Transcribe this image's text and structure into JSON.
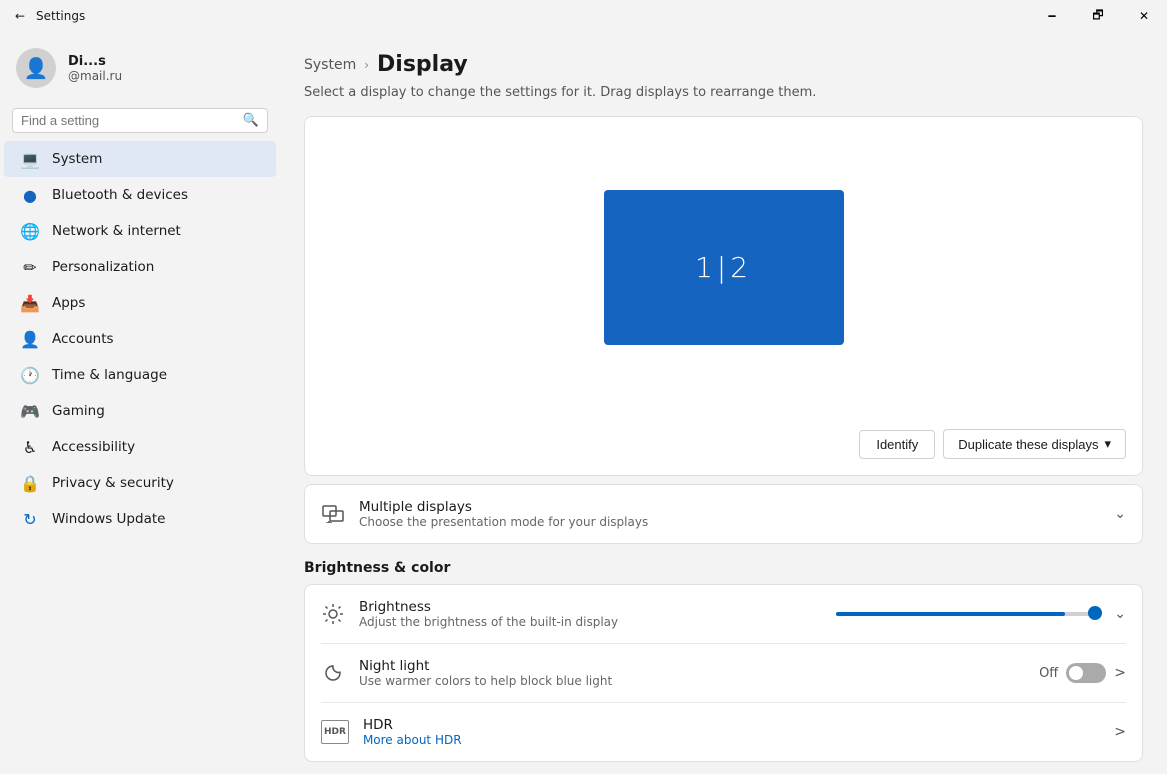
{
  "titlebar": {
    "app_name": "Settings",
    "back_label": "←",
    "minimize_label": "🗕",
    "maximize_label": "🗗",
    "close_label": "✕"
  },
  "sidebar": {
    "user": {
      "name": "Di...s",
      "email": "@mail.ru",
      "avatar_icon": "👤"
    },
    "search": {
      "placeholder": "Find a setting",
      "icon": "🔍"
    },
    "nav_items": [
      {
        "id": "system",
        "label": "System",
        "icon": "💻",
        "active": true
      },
      {
        "id": "bluetooth",
        "label": "Bluetooth & devices",
        "icon": "🔵"
      },
      {
        "id": "network",
        "label": "Network & internet",
        "icon": "🌐"
      },
      {
        "id": "personalization",
        "label": "Personalization",
        "icon": "✏️"
      },
      {
        "id": "apps",
        "label": "Apps",
        "icon": "📦"
      },
      {
        "id": "accounts",
        "label": "Accounts",
        "icon": "👤"
      },
      {
        "id": "time",
        "label": "Time & language",
        "icon": "🕐"
      },
      {
        "id": "gaming",
        "label": "Gaming",
        "icon": "🎮"
      },
      {
        "id": "accessibility",
        "label": "Accessibility",
        "icon": "♿"
      },
      {
        "id": "privacy",
        "label": "Privacy & security",
        "icon": "🔒"
      },
      {
        "id": "windows_update",
        "label": "Windows Update",
        "icon": "🔄"
      }
    ]
  },
  "main": {
    "breadcrumb_parent": "System",
    "breadcrumb_arrow": "›",
    "page_title": "Display",
    "page_subtitle": "Select a display to change the settings for it. Drag displays to rearrange them.",
    "display_preview": {
      "label": "1|2"
    },
    "identify_label": "Identify",
    "duplicate_label": "Duplicate these displays",
    "duplicate_chevron": "▾",
    "multiple_displays": {
      "title": "Multiple displays",
      "subtitle": "Choose the presentation mode for your displays",
      "icon": "🖥"
    },
    "brightness_color_heading": "Brightness & color",
    "brightness": {
      "title": "Brightness",
      "subtitle": "Adjust the brightness of the built-in display",
      "icon": "☀",
      "value_pct": 88
    },
    "night_light": {
      "title": "Night light",
      "subtitle": "Use warmer colors to help block blue light",
      "icon": "🌙",
      "status": "Off"
    },
    "hdr": {
      "title": "HDR",
      "badge": "HDR",
      "link_text": "More about HDR",
      "icon": "HDR"
    }
  }
}
